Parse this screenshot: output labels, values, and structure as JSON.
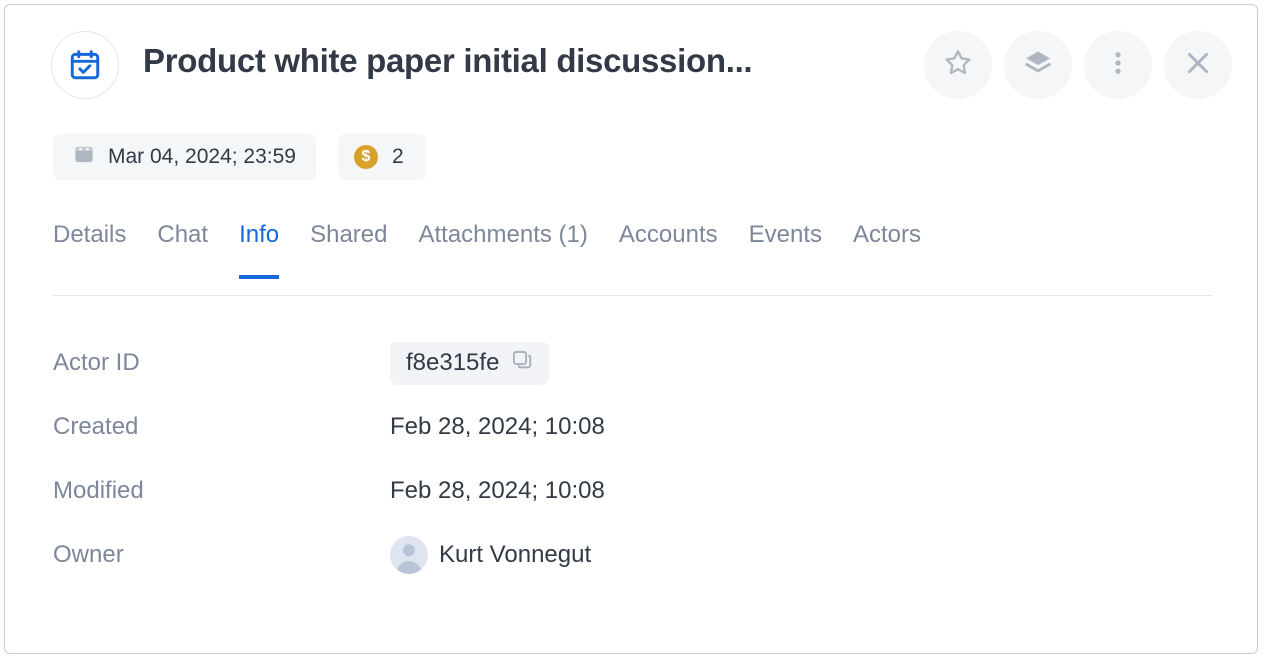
{
  "header": {
    "doc_icon": "calendar-check-icon",
    "title": "Product white paper initial discussion...",
    "actions": [
      {
        "name": "favorite-button",
        "icon": "star-icon"
      },
      {
        "name": "layers-button",
        "icon": "layers-icon"
      },
      {
        "name": "more-options-button",
        "icon": "three-dots-vertical-icon"
      },
      {
        "name": "close-button",
        "icon": "close-icon"
      }
    ]
  },
  "chips": {
    "date": {
      "icon": "calendar-icon",
      "text": "Mar 04, 2024; 23:59"
    },
    "coin": {
      "icon": "dollar-coin-icon",
      "symbol": "$",
      "value": "2"
    }
  },
  "tabs": [
    {
      "label": "Details",
      "active": false
    },
    {
      "label": "Chat",
      "active": false
    },
    {
      "label": "Info",
      "active": true
    },
    {
      "label": "Shared",
      "active": false
    },
    {
      "label": "Attachments (1)",
      "active": false
    },
    {
      "label": "Accounts",
      "active": false
    },
    {
      "label": "Events",
      "active": false
    },
    {
      "label": "Actors",
      "active": false
    }
  ],
  "info": {
    "actor_id": {
      "label": "Actor ID",
      "value": "f8e315fe",
      "copy_icon": "copy-icon"
    },
    "created": {
      "label": "Created",
      "value": "Feb 28, 2024; 10:08"
    },
    "modified": {
      "label": "Modified",
      "value": "Feb 28, 2024; 10:08"
    },
    "owner": {
      "label": "Owner",
      "value": "Kurt Vonnegut",
      "avatar": "default-avatar"
    }
  },
  "colors": {
    "accent": "#1668dc",
    "coin": "#d8a12a",
    "label": "#7d8799",
    "text": "#313a46",
    "chip_bg": "#f4f6f8"
  }
}
